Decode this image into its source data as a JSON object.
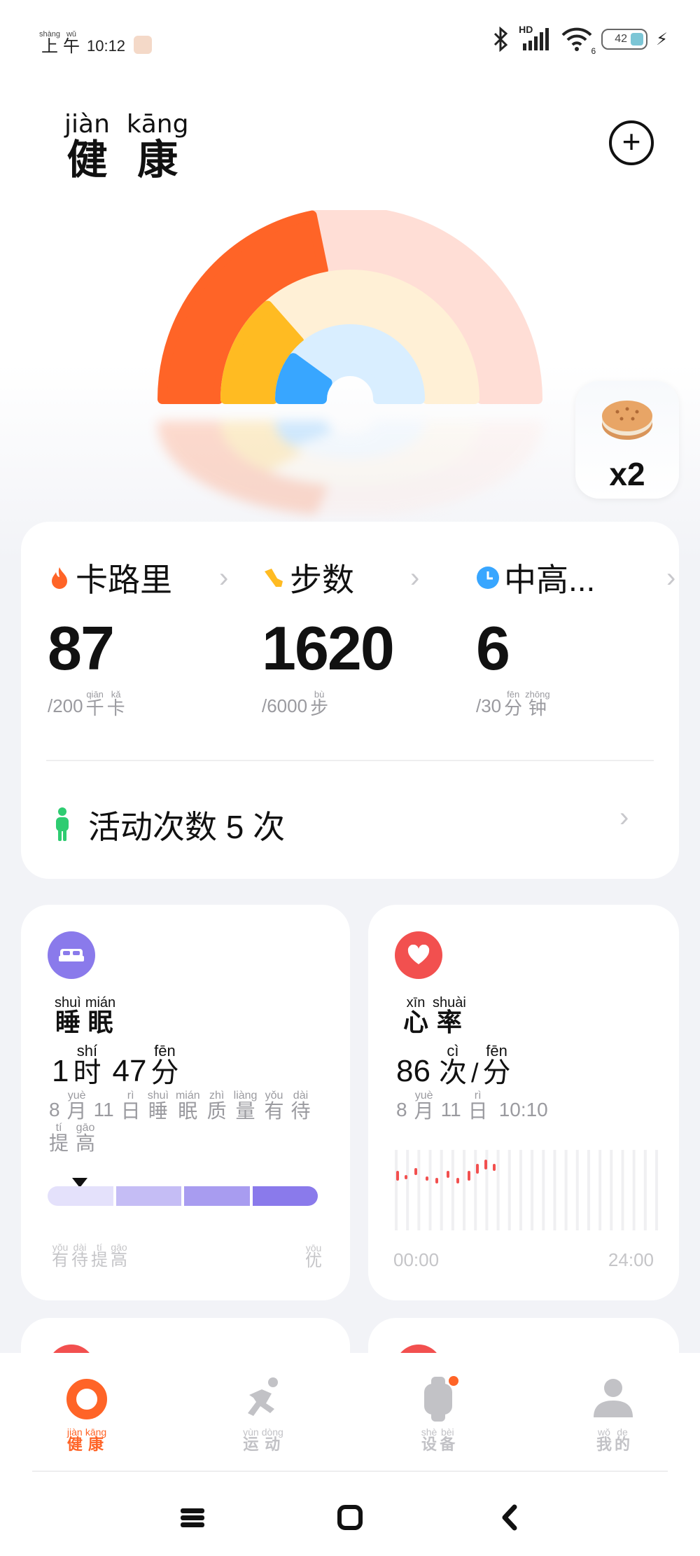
{
  "status_bar": {
    "time_chars": [
      {
        "py": "shàng",
        "ch": "上"
      },
      {
        "py": "wǔ",
        "ch": "午"
      }
    ],
    "time": "10:12",
    "signal_label": "HD",
    "wifi_label": "6",
    "battery": "42"
  },
  "header": {
    "title": [
      {
        "py": "jiàn",
        "ch": "健"
      },
      {
        "py": "kāng",
        "ch": "康"
      }
    ],
    "add_icon": "plus-circle-icon"
  },
  "rings": {
    "calories_progress": 0.435,
    "steps_progress": 0.27,
    "minutes_progress": 0.2,
    "colors": {
      "calories": "#ff6427",
      "calories_track": "#ffded6",
      "steps": "#ffbb22",
      "steps_track": "#fff0d6",
      "minutes": "#38a6ff",
      "minutes_track": "#d9eeff"
    }
  },
  "reward": {
    "count": "x2",
    "icon": "cookie-icon"
  },
  "summary": {
    "metrics": [
      {
        "label": "卡路里",
        "value": "87",
        "goal": "/200",
        "unit": [
          {
            "py": "qiān",
            "ch": "千"
          },
          {
            "py": "kǎ",
            "ch": "卡"
          }
        ],
        "icon": "flame-icon",
        "color": "#ff6427"
      },
      {
        "label": "步数",
        "value": "1620",
        "goal": "/6000",
        "unit": [
          {
            "py": "bù",
            "ch": "步"
          }
        ],
        "icon": "shoe-icon",
        "color": "#ffbb22"
      },
      {
        "label": "中高...",
        "value": "6",
        "goal": "/30",
        "unit": [
          {
            "py": "fēn",
            "ch": "分"
          },
          {
            "py": "zhōng",
            "ch": "钟"
          }
        ],
        "icon": "clock-icon",
        "color": "#38a6ff"
      }
    ],
    "activity": "活动次数 5 次",
    "activity_icon": "person-standing-icon"
  },
  "sleep_card": {
    "title": [
      {
        "py": "shuì",
        "ch": "睡"
      },
      {
        "py": "mián",
        "ch": "眠"
      }
    ],
    "hours": "1",
    "hours_unit": {
      "py": "shí",
      "ch": "时"
    },
    "minutes": "47",
    "minutes_unit": {
      "py": "fēn",
      "ch": "分"
    },
    "date_num_1": "8",
    "date_num_2": "11",
    "sub": [
      {
        "py": "yuè",
        "ch": "月"
      },
      {
        "py": "rì",
        "ch": "日"
      },
      {
        "py": "shuì",
        "ch": "睡"
      },
      {
        "py": "mián",
        "ch": "眠"
      },
      {
        "py": "zhì",
        "ch": "质"
      },
      {
        "py": "liàng",
        "ch": "量"
      },
      {
        "py": "yǒu",
        "ch": "有"
      },
      {
        "py": "dài",
        "ch": "待"
      },
      {
        "py": "tí",
        "ch": "提"
      },
      {
        "py": "gāo",
        "ch": "高"
      }
    ],
    "scale_left": [
      {
        "py": "yǒu",
        "ch": "有"
      },
      {
        "py": "dài",
        "ch": "待"
      },
      {
        "py": "tí",
        "ch": "提"
      },
      {
        "py": "gāo",
        "ch": "高"
      }
    ],
    "scale_right": {
      "py": "yōu",
      "ch": "优"
    },
    "level_fraction": 0.12,
    "bar_colors": [
      "#e4e1fb",
      "#c5bdf5",
      "#a89cf0",
      "#8a7aeb"
    ],
    "icon": "bed-icon",
    "icon_color": "#8a7aeb"
  },
  "heart_card": {
    "title": [
      {
        "py": "xīn",
        "ch": "心"
      },
      {
        "py": "shuài",
        "ch": "率"
      }
    ],
    "value": "86",
    "unit_1": {
      "py": "cì",
      "ch": "次"
    },
    "slash": "/",
    "unit_2": {
      "py": "fēn",
      "ch": "分"
    },
    "date_num_1": "8",
    "date_num_2": "11",
    "date_chars": [
      {
        "py": "yuè",
        "ch": "月"
      },
      {
        "py": "rì",
        "ch": "日"
      }
    ],
    "time": "10:10",
    "axis_start": "00:00",
    "axis_end": "24:00",
    "icon": "heart-icon",
    "icon_color": "#f2504f"
  },
  "bottom_nav": [
    {
      "label": [
        {
          "py": "jiàn",
          "ch": "健"
        },
        {
          "py": "kāng",
          "ch": "康"
        }
      ],
      "icon": "health-ring-icon",
      "active": true
    },
    {
      "label": [
        {
          "py": "yùn",
          "ch": "运"
        },
        {
          "py": "dòng",
          "ch": "动"
        }
      ],
      "icon": "running-icon",
      "active": false
    },
    {
      "label": [
        {
          "py": "shè",
          "ch": "设"
        },
        {
          "py": "bèi",
          "ch": "备"
        }
      ],
      "icon": "watch-icon",
      "active": false
    },
    {
      "label": [
        {
          "py": "wǒ",
          "ch": "我"
        },
        {
          "py": "de",
          "ch": "的"
        }
      ],
      "icon": "profile-icon",
      "active": false
    }
  ],
  "system_nav": [
    "menu-icon",
    "home-icon",
    "back-icon"
  ],
  "colors": {
    "active_tab": "#ff6427",
    "inactive_tab": "#c2c2c6"
  }
}
